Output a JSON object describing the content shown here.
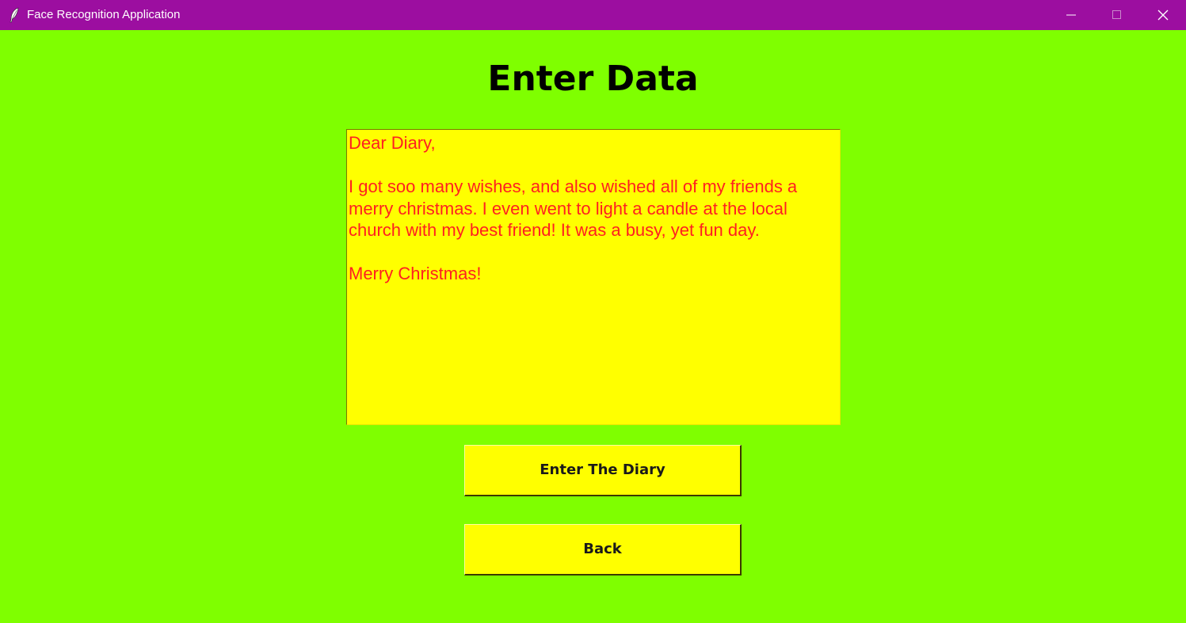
{
  "window": {
    "title": "Face Recognition Application",
    "icon": "feather-icon",
    "controls": [
      "minimize-icon",
      "maximize-icon",
      "close-icon"
    ],
    "titlebar_color": "#9c0ea0",
    "background_color": "#7fff00"
  },
  "main": {
    "heading": "Enter Data",
    "diary": {
      "text": "Dear Diary,\n\nI got soo many wishes, and also wished all of my friends a\nmerry christmas. I even went to light a candle at the local\nchurch with my best friend! It was a busy, yet fun day.\n\nMerry Christmas!",
      "background_color": "#ffff00",
      "text_color": "#ff2020"
    },
    "buttons": {
      "enter_label": "Enter The Diary",
      "back_label": "Back",
      "background_color": "#ffff00"
    }
  }
}
